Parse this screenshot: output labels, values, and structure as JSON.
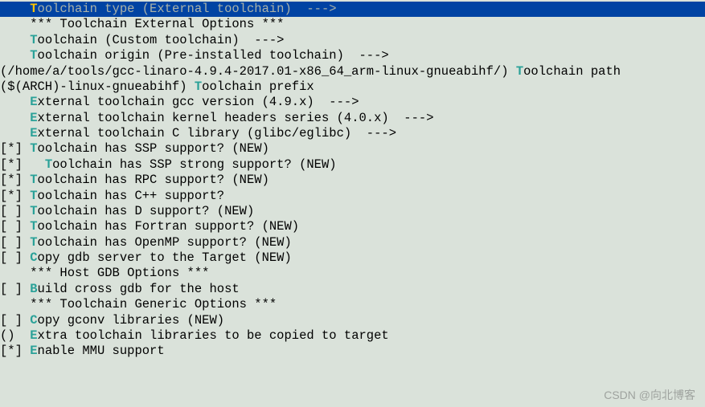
{
  "lines": [
    {
      "prefix": "    ",
      "hotkey": "T",
      "rest": "oolchain type (External toolchain)  --->",
      "selected": true
    },
    {
      "prefix": "    ",
      "hotkey": "",
      "rest": "*** Toolchain External Options ***",
      "selected": false
    },
    {
      "prefix": "    ",
      "hotkey": "T",
      "rest": "oolchain (Custom toolchain)  --->",
      "selected": false
    },
    {
      "prefix": "    ",
      "hotkey": "T",
      "rest": "oolchain origin (Pre-installed toolchain)  --->",
      "selected": false
    }
  ],
  "path_line": {
    "left": "(/home/a/tools/gcc-linaro-4.9.4-2017.01-x86_64_arm-linux-gnueabihf/) ",
    "hotkey": "T",
    "rest": "oolchain path"
  },
  "prefix_line": {
    "left": "($(ARCH)-linux-gnueabihf) ",
    "hotkey": "T",
    "rest": "oolchain prefix"
  },
  "ext_lines": [
    {
      "prefix": "    ",
      "hotkey": "E",
      "rest": "xternal toolchain gcc version (4.9.x)  --->"
    },
    {
      "prefix": "    ",
      "hotkey": "E",
      "rest": "xternal toolchain kernel headers series (4.0.x)  --->"
    },
    {
      "prefix": "    ",
      "hotkey": "E",
      "rest": "xternal toolchain C library (glibc/eglibc)  --->"
    }
  ],
  "check_lines": [
    {
      "mark": "[*] ",
      "hotkey": "T",
      "rest": "oolchain has SSP support? (NEW)"
    },
    {
      "mark": "[*]   ",
      "hotkey": "T",
      "rest": "oolchain has SSP strong support? (NEW)"
    },
    {
      "mark": "[*] ",
      "hotkey": "T",
      "rest": "oolchain has RPC support? (NEW)"
    },
    {
      "mark": "[*] ",
      "hotkey": "T",
      "rest": "oolchain has C++ support?"
    },
    {
      "mark": "[ ] ",
      "hotkey": "T",
      "rest": "oolchain has D support? (NEW)"
    },
    {
      "mark": "[ ] ",
      "hotkey": "T",
      "rest": "oolchain has Fortran support? (NEW)"
    },
    {
      "mark": "[ ] ",
      "hotkey": "T",
      "rest": "oolchain has OpenMP support? (NEW)"
    },
    {
      "mark": "[ ] ",
      "hotkey": "C",
      "rest": "opy gdb server to the Target (NEW)"
    },
    {
      "mark": "    ",
      "hotkey": "",
      "rest": "*** Host GDB Options ***"
    },
    {
      "mark": "[ ] ",
      "hotkey": "B",
      "rest": "uild cross gdb for the host"
    },
    {
      "mark": "    ",
      "hotkey": "",
      "rest": "*** Toolchain Generic Options ***"
    },
    {
      "mark": "[ ] ",
      "hotkey": "C",
      "rest": "opy gconv libraries (NEW)"
    },
    {
      "mark": "()  ",
      "hotkey": "E",
      "rest": "xtra toolchain libraries to be copied to target"
    },
    {
      "mark": "[*] ",
      "hotkey": "E",
      "rest": "nable MMU support"
    }
  ],
  "watermark": "CSDN @向北博客"
}
